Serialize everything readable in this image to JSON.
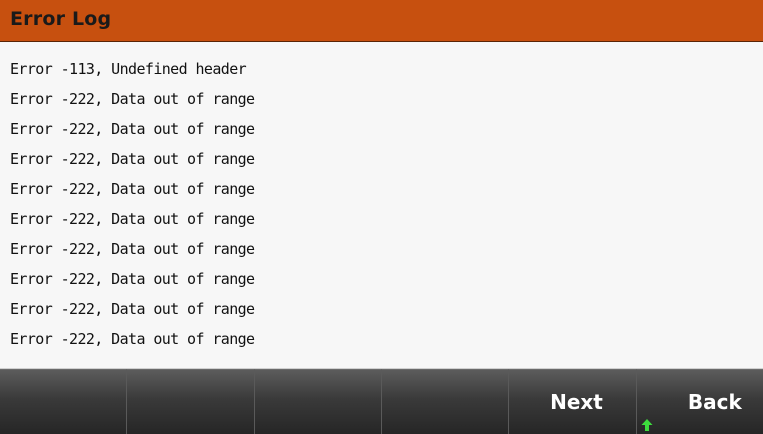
{
  "header": {
    "title": "Error Log"
  },
  "log": {
    "entries": [
      "Error -113, Undefined header",
      "Error -222, Data out of range",
      "Error -222, Data out of range",
      "Error -222, Data out of range",
      "Error -222, Data out of range",
      "Error -222, Data out of range",
      "Error -222, Data out of range",
      "Error -222, Data out of range",
      "Error -222, Data out of range",
      "Error -222, Data out of range"
    ]
  },
  "softkeys": {
    "key1": "",
    "key2": "",
    "key3": "",
    "key4": "",
    "next_label": "Next",
    "back_label": "Back",
    "back_icon": "up-arrow-icon"
  },
  "colors": {
    "title_bar": "#c7500f",
    "arrow": "#3ddc3d"
  }
}
